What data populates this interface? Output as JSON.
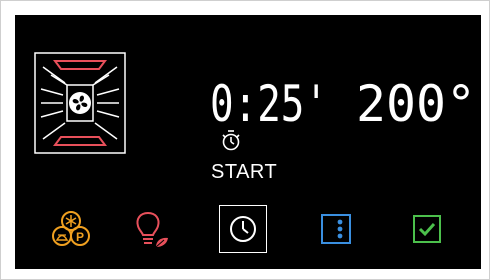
{
  "display": {
    "time": "0:25'",
    "temperature": "200°",
    "start_label": "START"
  },
  "icons": {
    "oven_mode": "fan-oven-top-bottom-heat-icon",
    "timer": "stopwatch-icon",
    "preset": "snowflake-pizza-preset-icon",
    "light": "lightbulb-leaf-icon",
    "clock": "clock-icon",
    "menu": "vertical-dots-menu-icon",
    "confirm": "checkmark-icon"
  },
  "colors": {
    "background": "#000000",
    "display_text": "#ffffff",
    "heater_accent": "#e8505b",
    "orange_accent": "#f0a020",
    "red_accent": "#e8505b",
    "blue_accent": "#3a8fe0",
    "green_accent": "#4cc04c"
  }
}
